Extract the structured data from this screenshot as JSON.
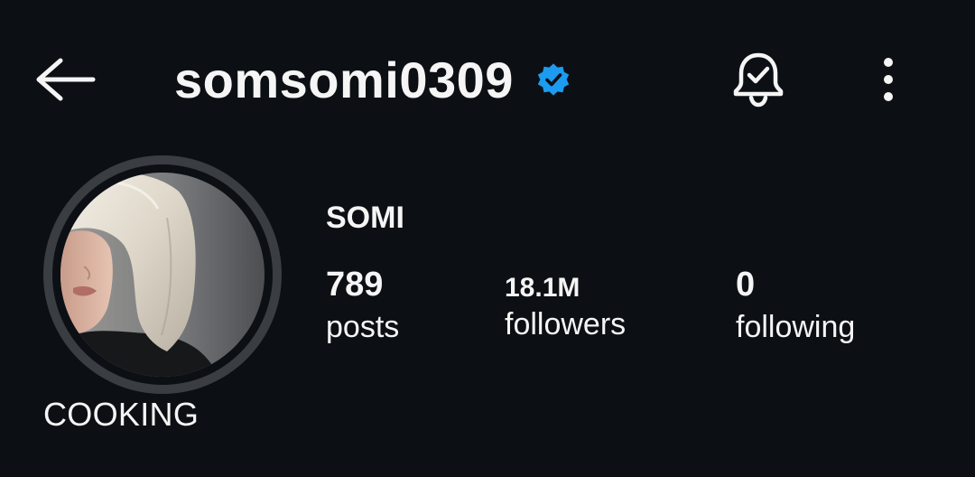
{
  "header": {
    "back_icon": "arrow-left-icon",
    "username": "somsomi0309",
    "verified": true,
    "verified_color": "#1d9bf0",
    "bell_icon": "bell-check-icon",
    "more_icon": "more-vertical-icon"
  },
  "profile": {
    "display_name": "SOMI",
    "note_label": "COOKING",
    "stats": {
      "posts": {
        "value": "789",
        "label": "posts"
      },
      "followers": {
        "value": "18.1M",
        "label": "followers"
      },
      "following": {
        "value": "0",
        "label": "following"
      }
    }
  },
  "colors": {
    "background": "#0c1014",
    "text": "#f5f5f5",
    "ring": "#3a3d42"
  }
}
